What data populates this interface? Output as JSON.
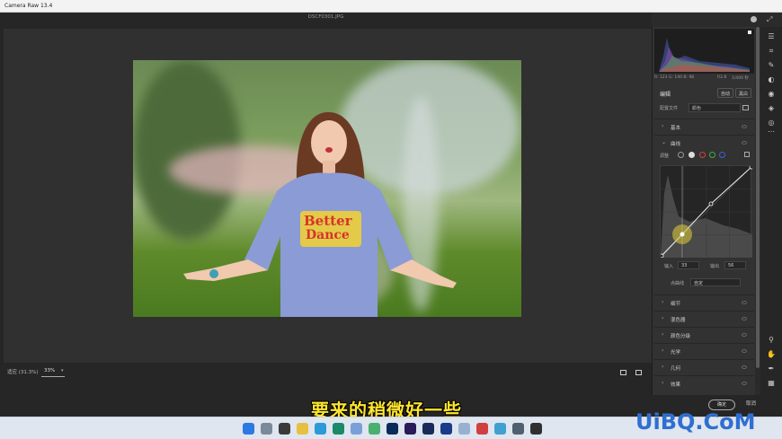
{
  "window": {
    "title": "Camera Raw 13.4"
  },
  "file": {
    "name": "DSCF0301.JPG"
  },
  "photo": {
    "shirt_text_line1": "Better",
    "shirt_text_line2": "Dance"
  },
  "bottombar": {
    "zoom_label": "适应 (31.3%)",
    "zoom_value": "33%"
  },
  "panel": {
    "info": {
      "rgb": "R: 123  G: 140  B: 98",
      "iso": "ISO 640  16mm",
      "aperture": "f/2.8",
      "shutter": "1/400 秒"
    },
    "edit_title": "编辑",
    "tab_auto": "自动",
    "tab_bw": "黑白",
    "profile_label": "配置文件",
    "profile_value": "颜色",
    "sections": {
      "basic": "基本",
      "curve": "曲线",
      "detail": "细节",
      "mixer": "混色器",
      "grading": "颜色分级",
      "optics": "光学",
      "geometry": "几何",
      "effects": "效果"
    },
    "curve_adjust_label": "调整",
    "input_label": "输入",
    "input_value": "33",
    "output_label": "输出",
    "output_value": "56",
    "point_curve_label": "点曲线",
    "point_curve_value": "自定"
  },
  "footer": {
    "ok": "确定",
    "cancel": "取消"
  },
  "subtitle": "要来的稍微好一些",
  "watermark": "UiBQ.CoM",
  "colors": {
    "accent": "#3b8ef0",
    "subtitle": "#ffe62e",
    "watermark": "#2f6fd1"
  }
}
